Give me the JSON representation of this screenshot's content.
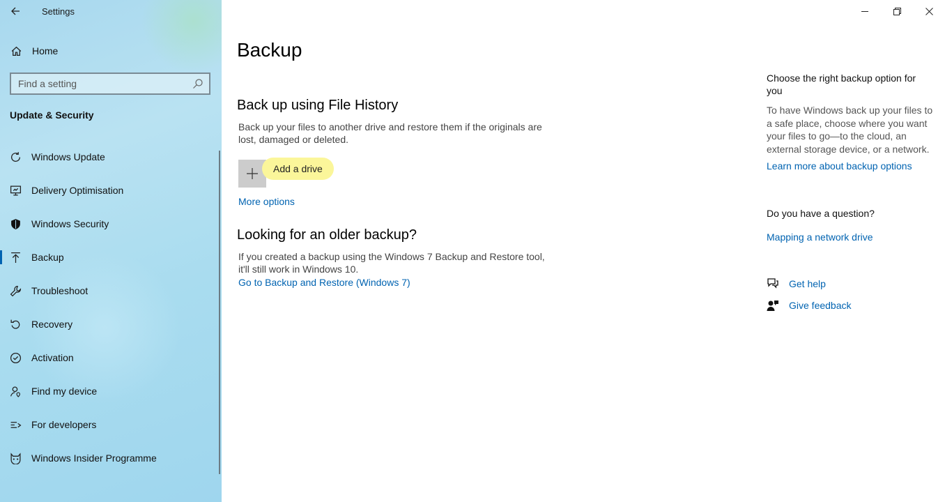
{
  "app": {
    "title": "Settings"
  },
  "sidebar": {
    "home_label": "Home",
    "search_placeholder": "Find a setting",
    "section_title": "Update & Security",
    "items": [
      {
        "label": "Windows Update",
        "icon": "refresh-icon"
      },
      {
        "label": "Delivery Optimisation",
        "icon": "delivery-optimisation-icon"
      },
      {
        "label": "Windows Security",
        "icon": "shield-icon"
      },
      {
        "label": "Backup",
        "icon": "backup-arrow-icon",
        "selected": true
      },
      {
        "label": "Troubleshoot",
        "icon": "wrench-icon"
      },
      {
        "label": "Recovery",
        "icon": "recovery-icon"
      },
      {
        "label": "Activation",
        "icon": "check-circle-icon"
      },
      {
        "label": "Find my device",
        "icon": "person-pin-icon"
      },
      {
        "label": "For developers",
        "icon": "developer-icon"
      },
      {
        "label": "Windows Insider Programme",
        "icon": "insider-cat-icon"
      }
    ]
  },
  "main": {
    "title": "Backup",
    "file_history": {
      "heading": "Back up using File History",
      "description": "Back up your files to another drive and restore them if the originals are lost, damaged or deleted.",
      "add_drive_label": "Add a drive",
      "more_options_label": "More options"
    },
    "older_backup": {
      "heading": "Looking for an older backup?",
      "description": "If you created a backup using the Windows 7 Backup and Restore tool, it'll still work in Windows 10.",
      "link_label": "Go to Backup and Restore (Windows 7)"
    }
  },
  "right_panel": {
    "choose_title": "Choose the right backup option for you",
    "choose_desc": "To have Windows back up your files to a safe place, choose where you want your files to go—to the cloud, an external storage device, or a network.",
    "learn_more_label": "Learn more about backup options",
    "question_title": "Do you have a question?",
    "mapping_label": "Mapping a network drive",
    "get_help_label": "Get help",
    "give_feedback_label": "Give feedback"
  },
  "colors": {
    "accent": "#0063b1",
    "highlight": "#fbf69a"
  }
}
